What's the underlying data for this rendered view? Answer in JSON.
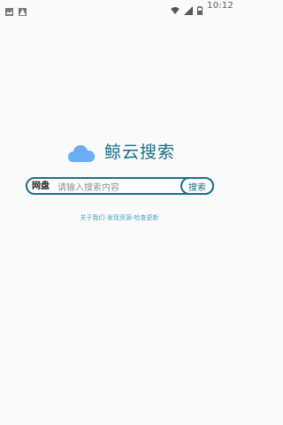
{
  "status_bar": {
    "time": "10:12",
    "left_icons": [
      "notification-icon",
      "warning-icon"
    ],
    "right_icons": [
      "wifi-icon",
      "cell-signal-icon",
      "battery-icon"
    ]
  },
  "logo": {
    "icon": "cloud-icon",
    "title": "鲸云搜索",
    "accent_color": "#1e6f86",
    "cloud_color": "#6aaef7"
  },
  "search": {
    "category": "网盘",
    "placeholder": "请输入搜索内容",
    "value": "",
    "button_label": "搜索"
  },
  "links": {
    "about": "关于我们",
    "sep1": "-",
    "discover": "发现资源",
    "sep2": "-",
    "update": "检查更新",
    "color": "#4aa3c6"
  }
}
